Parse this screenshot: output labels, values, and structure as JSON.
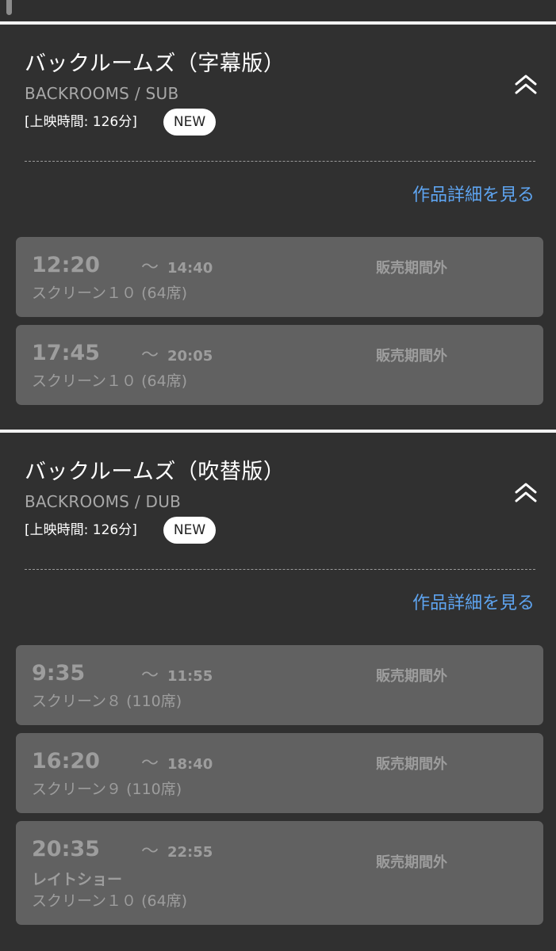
{
  "movies": [
    {
      "title": "バックルームズ（字幕版）",
      "subtitle": "BACKROOMS / SUB",
      "runtime": "[上映時間: 126分]",
      "badge": "NEW",
      "details_link": "作品詳細を見る",
      "collapse_icon": "chevron-double-up-icon",
      "showtimes": [
        {
          "start": "12:20",
          "tilde": "～",
          "end": "14:40",
          "status": "販売期間外",
          "screen": "スクリーン１０ (64席)"
        },
        {
          "start": "17:45",
          "tilde": "～",
          "end": "20:05",
          "status": "販売期間外",
          "screen": "スクリーン１０ (64席)"
        }
      ]
    },
    {
      "title": "バックルームズ（吹替版）",
      "subtitle": "BACKROOMS / DUB",
      "runtime": "[上映時間: 126分]",
      "badge": "NEW",
      "details_link": "作品詳細を見る",
      "collapse_icon": "chevron-double-up-icon",
      "showtimes": [
        {
          "start": "9:35",
          "tilde": "～",
          "end": "11:55",
          "status": "販売期間外",
          "screen": "スクリーン８ (110席)"
        },
        {
          "start": "16:20",
          "tilde": "～",
          "end": "18:40",
          "status": "販売期間外",
          "screen": "スクリーン９ (110席)"
        },
        {
          "start": "20:35",
          "tilde": "～",
          "end": "22:55",
          "status": "販売期間外",
          "note": "レイトショー",
          "screen": "スクリーン１０ (64席)"
        }
      ]
    }
  ],
  "colors": {
    "background": "#303030",
    "card": "#616161",
    "card_text": "#9d9d9d",
    "link": "#5ea4f0",
    "badge_bg": "#ffffff"
  }
}
